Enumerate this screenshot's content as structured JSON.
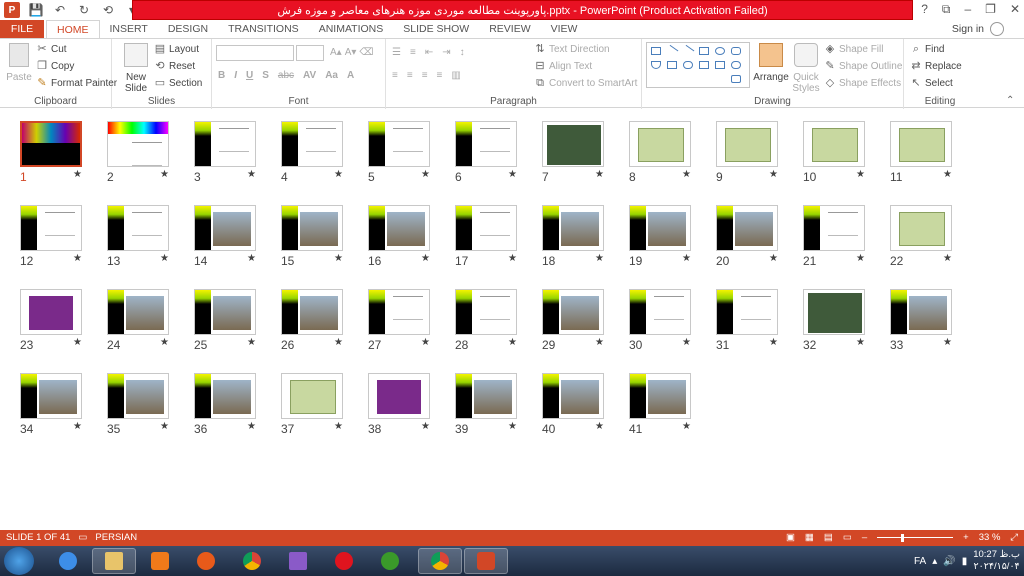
{
  "app": {
    "title": "پاورپوینت مطالعه موردی موزه هنرهای معاصر و موزه فرش.pptx - PowerPoint (Product Activation Failed)",
    "logo_label": "P",
    "window_controls": [
      "?",
      "⧉",
      "–",
      "❐",
      "✕"
    ]
  },
  "qat": [
    "💾",
    "↶",
    "↻",
    "⟲",
    "▾"
  ],
  "tabs": [
    "FILE",
    "HOME",
    "INSERT",
    "DESIGN",
    "TRANSITIONS",
    "ANIMATIONS",
    "SLIDE SHOW",
    "REVIEW",
    "VIEW"
  ],
  "active_tab": "HOME",
  "signin": "Sign in",
  "ribbon": {
    "clipboard": {
      "label": "Clipboard",
      "paste": "Paste",
      "cut": "Cut",
      "copy": "Copy",
      "format_painter": "Format Painter"
    },
    "slides": {
      "label": "Slides",
      "new_slide": "New Slide",
      "layout": "Layout",
      "reset": "Reset",
      "section": "Section"
    },
    "font": {
      "label": "Font",
      "buttons": [
        "B",
        "I",
        "U",
        "S",
        "abc",
        "AV",
        "Aa",
        "A"
      ]
    },
    "paragraph": {
      "label": "Paragraph",
      "text_direction": "Text Direction",
      "align_text": "Align Text",
      "convert_smartart": "Convert to SmartArt"
    },
    "drawing": {
      "label": "Drawing",
      "arrange": "Arrange",
      "quick_styles": "Quick Styles",
      "shape_fill": "Shape Fill",
      "shape_outline": "Shape Outline",
      "shape_effects": "Shape Effects"
    },
    "editing": {
      "label": "Editing",
      "find": "Find",
      "replace": "Replace",
      "select": "Select"
    }
  },
  "slides": [
    {
      "num": "1",
      "kind": "title"
    },
    {
      "num": "2",
      "kind": "colorbar"
    },
    {
      "num": "3",
      "kind": "text"
    },
    {
      "num": "4",
      "kind": "text"
    },
    {
      "num": "5",
      "kind": "text"
    },
    {
      "num": "6",
      "kind": "text"
    },
    {
      "num": "7",
      "kind": "map"
    },
    {
      "num": "8",
      "kind": "plan"
    },
    {
      "num": "9",
      "kind": "plan"
    },
    {
      "num": "10",
      "kind": "plan"
    },
    {
      "num": "11",
      "kind": "plan"
    },
    {
      "num": "12",
      "kind": "text"
    },
    {
      "num": "13",
      "kind": "text"
    },
    {
      "num": "14",
      "kind": "photo"
    },
    {
      "num": "15",
      "kind": "photo"
    },
    {
      "num": "16",
      "kind": "photo"
    },
    {
      "num": "17",
      "kind": "text"
    },
    {
      "num": "18",
      "kind": "photo"
    },
    {
      "num": "19",
      "kind": "photo"
    },
    {
      "num": "20",
      "kind": "photo"
    },
    {
      "num": "21",
      "kind": "text"
    },
    {
      "num": "22",
      "kind": "plan"
    },
    {
      "num": "23",
      "kind": "diagram"
    },
    {
      "num": "24",
      "kind": "photo"
    },
    {
      "num": "25",
      "kind": "photo"
    },
    {
      "num": "26",
      "kind": "photo"
    },
    {
      "num": "27",
      "kind": "text"
    },
    {
      "num": "28",
      "kind": "text"
    },
    {
      "num": "29",
      "kind": "photo"
    },
    {
      "num": "30",
      "kind": "text"
    },
    {
      "num": "31",
      "kind": "text"
    },
    {
      "num": "32",
      "kind": "map"
    },
    {
      "num": "33",
      "kind": "photo"
    },
    {
      "num": "34",
      "kind": "photo"
    },
    {
      "num": "35",
      "kind": "photo"
    },
    {
      "num": "36",
      "kind": "photo"
    },
    {
      "num": "37",
      "kind": "plan"
    },
    {
      "num": "38",
      "kind": "diagram"
    },
    {
      "num": "39",
      "kind": "photo"
    },
    {
      "num": "40",
      "kind": "photo"
    },
    {
      "num": "41",
      "kind": "photo"
    }
  ],
  "status": {
    "slide_info": "SLIDE 1 OF 41",
    "language": "PERSIAN",
    "zoom": "33 %",
    "zoom_fraction": 0.33
  },
  "taskbar": {
    "lang": "FA",
    "time": "10:27 ب.ظ",
    "date": "۲۰۲۴/۱۵/۰۴"
  }
}
